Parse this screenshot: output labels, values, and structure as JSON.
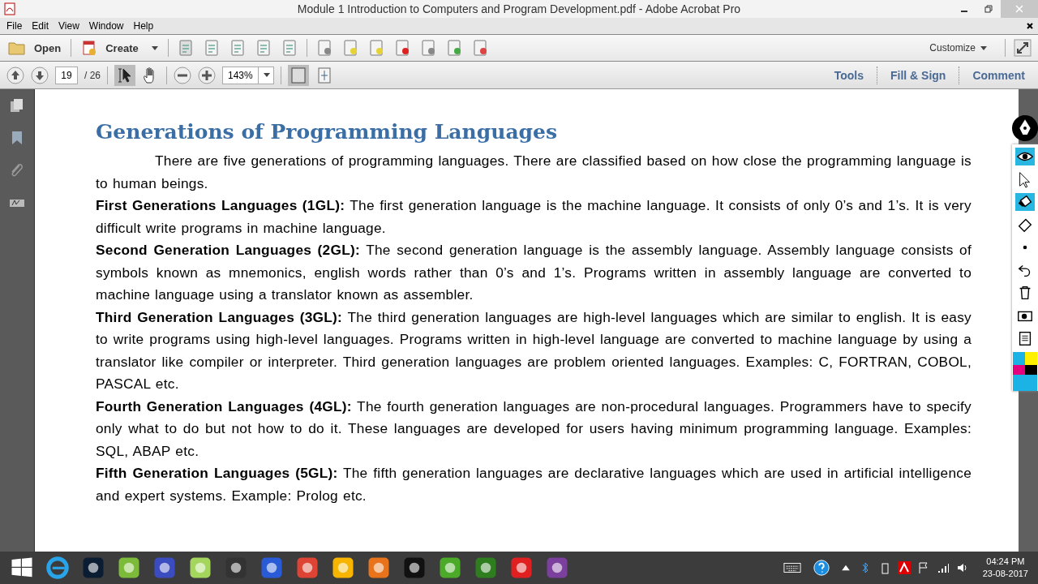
{
  "window": {
    "title": "Module 1 Introduction to Computers and Program Development.pdf - Adobe Acrobat Pro"
  },
  "menu": [
    "File",
    "Edit",
    "View",
    "Window",
    "Help"
  ],
  "toolbar": {
    "open": "Open",
    "create": "Create",
    "customize": "Customize"
  },
  "navbar": {
    "page": "19",
    "page_count": "/ 26",
    "zoom": "143%",
    "panels": [
      "Tools",
      "Fill & Sign",
      "Comment"
    ]
  },
  "document": {
    "heading": "Generations of Programming Languages",
    "paragraphs": [
      {
        "kind": "intro",
        "text": "There are five generations of programming languages. There are classified based on how close the programming language is to human beings."
      },
      {
        "kind": "item",
        "text": "**First Generations Languages (1GL):** The first generation language is the machine language. It consists of only 0’s and 1’s. It is very difficult write programs in machine language."
      },
      {
        "kind": "item",
        "text": "**Second Generation Languages (2GL):** The second generation language is the assembly language. Assembly language consists of symbols known as mnemonics, english words rather than 0’s and 1’s. Programs written in assembly language are converted to machine language using a translator known as assembler."
      },
      {
        "kind": "item",
        "text": "**Third Generation Languages (3GL):** The third generation languages are high-level languages which are similar to english. It is easy to write programs using high-level languages. Programs written in high-level language are converted to machine language by using a translator like compiler or interpreter. Third generation languages are problem oriented languages. Examples: C, FORTRAN, COBOL, PASCAL etc."
      },
      {
        "kind": "item",
        "text": "**Fourth Generation Languages (4GL):** The fourth generation languages are non-procedural languages. Programmers have to specify only what to do but not how to do it. These languages are developed for users having minimum programming language. Examples: SQL, ABAP etc."
      },
      {
        "kind": "item",
        "text": "**Fifth Generation Languages (5GL):** The fifth generation languages are declarative languages which are used in artificial intelligence and expert systems. Example: Prolog etc."
      }
    ]
  },
  "taskbar": {
    "time": "04:24 PM",
    "date": "23-08-2017"
  }
}
